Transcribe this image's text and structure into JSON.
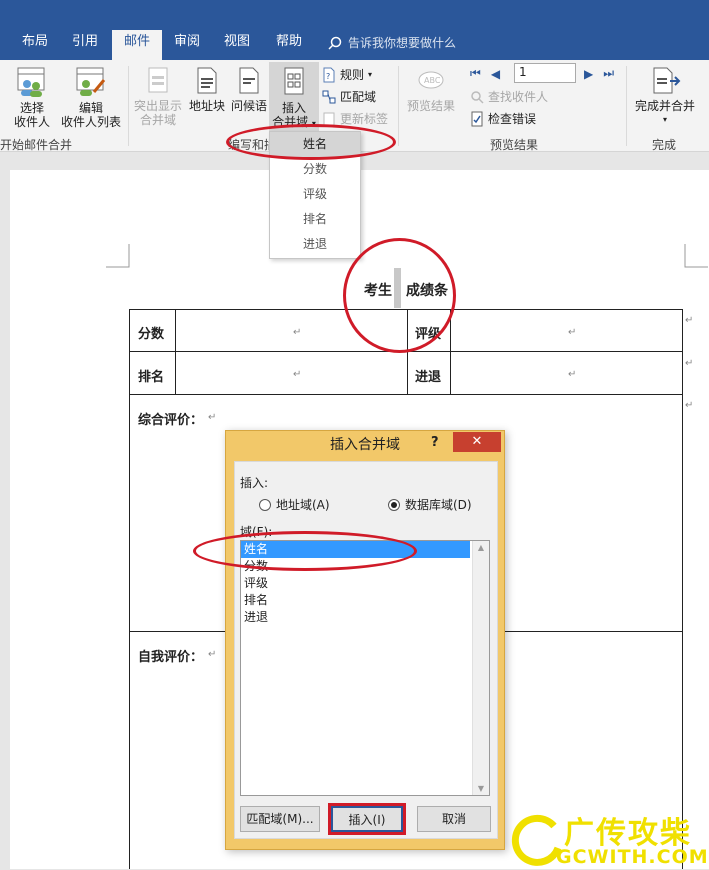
{
  "tabs": [
    "布局",
    "引用",
    "邮件",
    "审阅",
    "视图",
    "帮助"
  ],
  "active_tab": "邮件",
  "tell_me": "告诉我你想要做什么",
  "ribbon": {
    "select_recipients": [
      "选择",
      "收件人"
    ],
    "edit_recipients": [
      "编辑",
      "收件人列表"
    ],
    "group_start": "开始邮件合并",
    "highlight_fields": [
      "突出显示",
      "合并域"
    ],
    "address_block": "地址块",
    "greeting": "问候语",
    "insert_merge_field": [
      "插入",
      "合并域"
    ],
    "rules": "规则",
    "match_fields": "匹配域",
    "update_labels": "更新标签",
    "group_write": "编写和插",
    "preview_results": "预览结果",
    "record_number": "1",
    "find_recipient": "查找收件人",
    "check_errors": "检查错误",
    "group_preview": "预览结果",
    "finish_merge": "完成并合并",
    "group_finish": "完成"
  },
  "dropdown": [
    "姓名",
    "分数",
    "评级",
    "排名",
    "进退"
  ],
  "document": {
    "title_left": "考生",
    "title_right": "成绩条",
    "row1": [
      "分数",
      "评级"
    ],
    "row2": [
      "排名",
      "进退"
    ],
    "overall": "综合评价：",
    "self": "自我评价："
  },
  "dialog": {
    "title": "插入合并域",
    "help": "?",
    "close": "✕",
    "insert_label": "插入:",
    "radio_address": "地址域(A)",
    "radio_database": "数据库域(D)",
    "fields_label": "域(F):",
    "fields": [
      "姓名",
      "分数",
      "评级",
      "排名",
      "进退"
    ],
    "btn_match": "匹配域(M)...",
    "btn_insert": "插入(I)",
    "btn_cancel": "取消"
  },
  "watermark": {
    "brand": "广传攻柴",
    "site": "GCWITH.COM"
  },
  "colors": {
    "tabbar": "#2b579a",
    "dialog_frame": "#f2c869",
    "annotation": "#d01b28",
    "selection": "#3399ff"
  }
}
